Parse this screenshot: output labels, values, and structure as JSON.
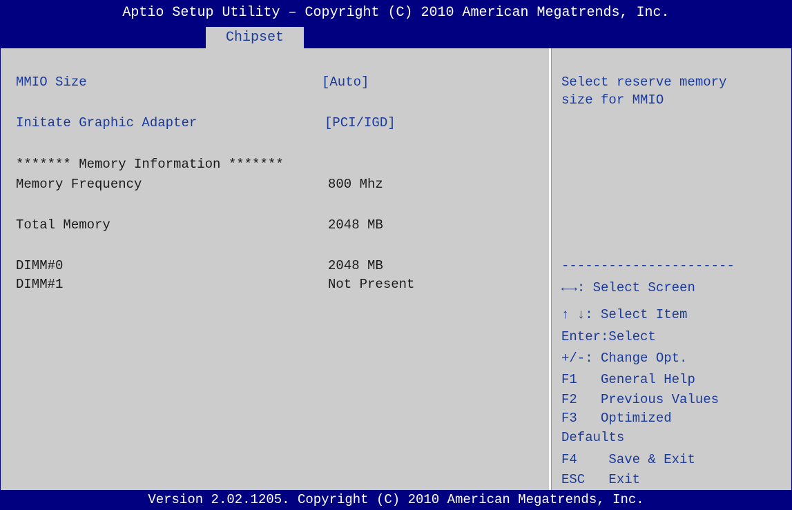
{
  "header": {
    "title": "Aptio Setup Utility – Copyright (C) 2010 American Megatrends, Inc.",
    "active_tab": "Chipset"
  },
  "settings": [
    {
      "label": "MMIO Size",
      "value": "[Auto]"
    },
    {
      "label": "Initate Graphic Adapter",
      "value": "[PCI/IGD]"
    }
  ],
  "memory_info": {
    "heading": "******* Memory Information *******",
    "rows": [
      {
        "label": "Memory Frequency",
        "value": "800 Mhz"
      },
      {
        "label": "Total Memory",
        "value": "2048 MB"
      },
      {
        "label": "DIMM#0",
        "value": "2048 MB"
      },
      {
        "label": "DIMM#1",
        "value": "Not Present"
      }
    ]
  },
  "help": {
    "description_line1": "Select reserve memory",
    "description_line2": "size for MMIO",
    "separator": "----------------------",
    "keys": [
      {
        "key": "←→",
        "desc": ": Select Screen"
      },
      {
        "key": "↑ ↓",
        "desc": ": Select Item"
      },
      {
        "key": "Enter",
        "desc": ":Select"
      },
      {
        "key": "+/-",
        "desc": ": Change Opt."
      },
      {
        "key": "F1",
        "desc": "   General Help"
      },
      {
        "key": "F2",
        "desc": "   Previous Values"
      },
      {
        "key": "F3",
        "desc": "   Optimized"
      },
      {
        "key": "",
        "desc": "Defaults"
      },
      {
        "key": "F4",
        "desc": "    Save & Exit"
      },
      {
        "key": "ESC",
        "desc": "   Exit"
      }
    ]
  },
  "footer": {
    "text": "Version 2.02.1205. Copyright (C) 2010 American Megatrends, Inc."
  },
  "colors": {
    "header_bg": "#000080",
    "panel_bg": "#cccccc",
    "selectable_text": "#1a3a9c",
    "static_text": "#1a1a1a"
  }
}
